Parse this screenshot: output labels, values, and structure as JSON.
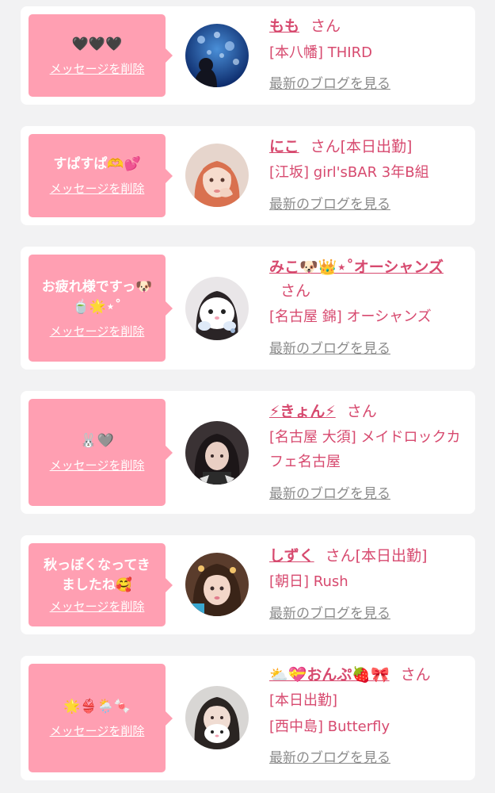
{
  "delete_label": "メッセージを削除",
  "blog_label": "最新のブログを見る",
  "honorific": "さん",
  "colors": {
    "background": "#f2f2f3",
    "card": "#ffffff",
    "bubble": "#ff9fb2",
    "accent_text": "#d74a6f",
    "link_gray": "#8b8b8b"
  },
  "items": [
    {
      "message": "🖤🖤🖤",
      "name": "もも",
      "name_suffix": "",
      "store": "[本八幡] THIRD"
    },
    {
      "message": "すぱすぱ🫶💕",
      "name": "にこ",
      "name_suffix": "[本日出勤]",
      "store": "[江坂] girl'sBAR 3年B組"
    },
    {
      "message": "お疲れ様ですっ🐶\n🍵🌟⋆˚",
      "name": "みこ🐶👑⋆˚オーシャンズ",
      "name_suffix": "",
      "store": "[名古屋 錦] オーシャンズ"
    },
    {
      "message": "🐰🩶",
      "name": "⚡きょん⚡",
      "name_suffix": "",
      "store": "[名古屋 大須] メイドロックカフェ名古屋"
    },
    {
      "message": "秋っぽくなってき\nましたね🥰",
      "name": "しずく",
      "name_suffix": "[本日出勤]",
      "store": "[朝日] Rush"
    },
    {
      "message": "🌟👙🌦️🍬",
      "name": "⛅💝おんぷ🍓🎀",
      "name_suffix": "",
      "status": "[本日出勤]",
      "store": "[西中島] Butterfly"
    }
  ]
}
